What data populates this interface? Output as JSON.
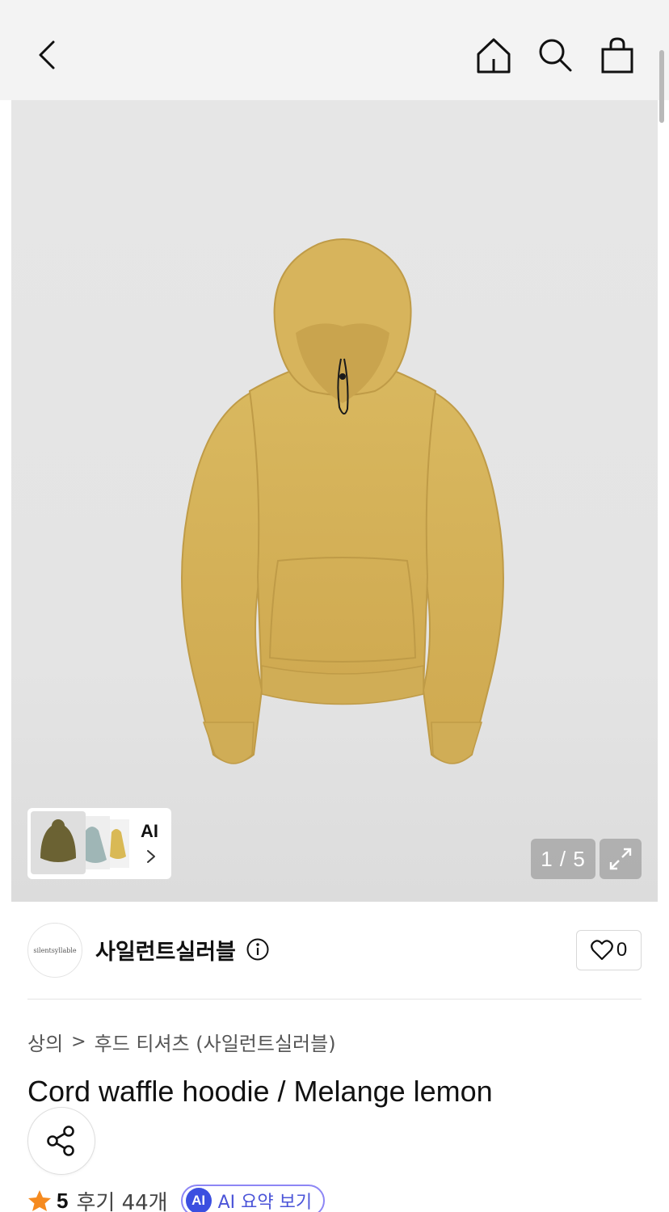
{
  "header": {
    "back_icon": "chevron-left-icon",
    "home_icon": "home-icon",
    "search_icon": "search-icon",
    "bag_icon": "shopping-bag-icon"
  },
  "gallery": {
    "image_alt": "Cord waffle hoodie / Melange lemon",
    "counter": "1 / 5",
    "current_index": 1,
    "total_images": 5,
    "ai_label": "AI",
    "expand_icon": "expand-icon",
    "thumb_colors": [
      "#6b6233",
      "#9fb6b6",
      "#d9b955"
    ],
    "product_color": "#d6b25a"
  },
  "brand": {
    "logo_text": "silentsyllable",
    "name": "사일런트실러블",
    "like_count": "0"
  },
  "breadcrumb": {
    "category": "상의",
    "separator": ">",
    "subcategory": "후드 티셔츠 (사일런트실러블)"
  },
  "product": {
    "title": "Cord waffle hoodie / Melange lemon"
  },
  "rating": {
    "value": "5",
    "review_label": "후기 44개",
    "ai_badge": "AI",
    "ai_summary_label": "AI 요약 보기",
    "star_color": "#f58a1f"
  }
}
